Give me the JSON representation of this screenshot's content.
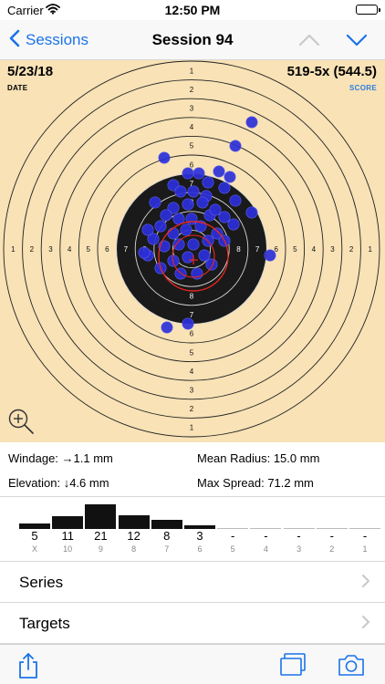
{
  "status_bar": {
    "carrier": "Carrier",
    "time": "12:50 PM"
  },
  "nav": {
    "back_label": "Sessions",
    "title": "Session 94",
    "icons": {
      "back": "chevron-left-icon",
      "previous": "chevron-up-icon",
      "next": "chevron-down-icon"
    }
  },
  "session": {
    "date": "5/23/18",
    "date_label": "DATE",
    "score": "519-5x (544.5)",
    "score_label": "SCORE"
  },
  "target": {
    "ring_labels": [
      "1",
      "2",
      "3",
      "4",
      "5",
      "6",
      "7",
      "8"
    ],
    "colors": {
      "paper": "#f8e2b6",
      "black": "#1a1a1a",
      "shot": "#2b2fd8",
      "group_circle": "#e8271e"
    },
    "icons": {
      "zoom": "zoom-in-icon"
    }
  },
  "stats": {
    "windage": "Windage: →1.1 mm",
    "elevation": "Elevation: ↓4.6 mm",
    "mean_radius": "Mean Radius: 15.0 mm",
    "max_spread": "Max Spread: 71.2 mm"
  },
  "histogram": {
    "columns": [
      {
        "count": "5",
        "ring": "X",
        "value": 5
      },
      {
        "count": "11",
        "ring": "10",
        "value": 11
      },
      {
        "count": "21",
        "ring": "9",
        "value": 21
      },
      {
        "count": "12",
        "ring": "8",
        "value": 12
      },
      {
        "count": "8",
        "ring": "7",
        "value": 8
      },
      {
        "count": "3",
        "ring": "6",
        "value": 3
      },
      {
        "count": "-",
        "ring": "5",
        "value": 0
      },
      {
        "count": "-",
        "ring": "4",
        "value": 0
      },
      {
        "count": "-",
        "ring": "3",
        "value": 0
      },
      {
        "count": "-",
        "ring": "2",
        "value": 0
      },
      {
        "count": "-",
        "ring": "1",
        "value": 0
      }
    ]
  },
  "menu": [
    {
      "label": "Series",
      "icon": "chevron-right-icon"
    },
    {
      "label": "Targets",
      "icon": "chevron-right-icon"
    }
  ],
  "toolbar": {
    "icons": {
      "share": "share-icon",
      "targets": "targets-stack-icon",
      "camera": "camera-icon"
    },
    "accent": "#1a73e8"
  }
}
